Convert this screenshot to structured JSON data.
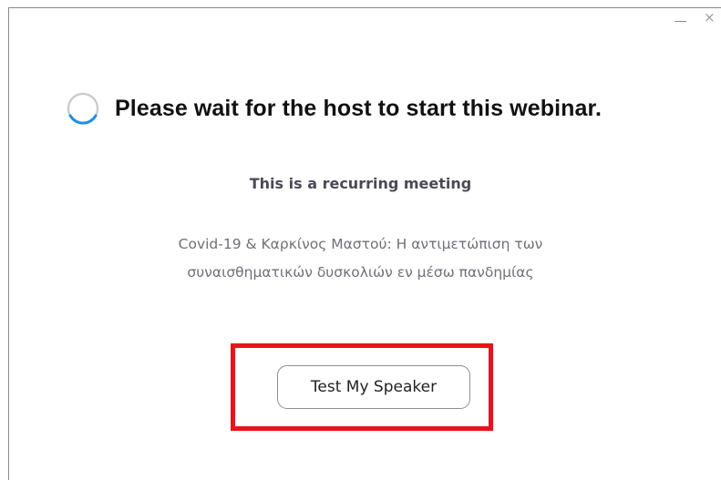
{
  "window": {
    "controls": {
      "minimize_glyph": "–",
      "close_glyph": "×"
    }
  },
  "waiting": {
    "title": "Please wait for the host to start this webinar.",
    "icon": "loading-spinner-icon",
    "spinner_color": "#1e8fe0"
  },
  "meeting": {
    "recurring_notice": "This is a recurring meeting",
    "topic_lines": [
      "Covid-19 & Καρκίνος Μαστού: Η αντιμετώπιση των",
      "συναισθηματικών δυσκολιών εν μέσω πανδημίας"
    ]
  },
  "actions": {
    "test_speaker_label": "Test My Speaker"
  },
  "annotation": {
    "highlight_color": "#e8141b"
  }
}
